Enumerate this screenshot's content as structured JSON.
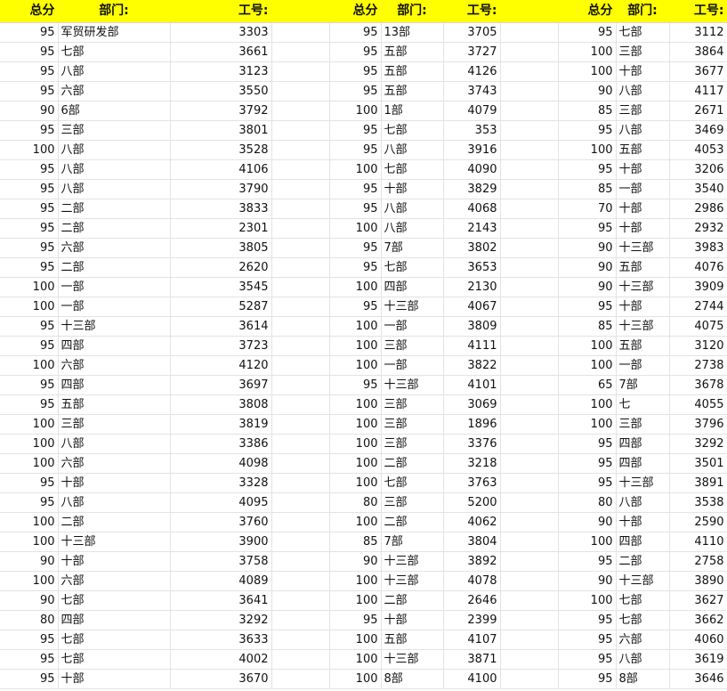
{
  "headers": {
    "score": "总分",
    "dept": "部门:",
    "id": "工号:"
  },
  "groups": [
    {
      "rows": [
        [
          "95",
          "军贸研发部",
          "3303"
        ],
        [
          "95",
          "七部",
          "3661"
        ],
        [
          "95",
          "八部",
          "3123"
        ],
        [
          "95",
          "六部",
          "3550"
        ],
        [
          "90",
          "6部",
          "3792"
        ],
        [
          "95",
          "三部",
          "3801"
        ],
        [
          "100",
          "八部",
          "3528"
        ],
        [
          "95",
          "八部",
          "4106"
        ],
        [
          "95",
          "八部",
          "3790"
        ],
        [
          "95",
          "二部",
          "3833"
        ],
        [
          "95",
          "二部",
          "2301"
        ],
        [
          "95",
          "六部",
          "3805"
        ],
        [
          "95",
          "二部",
          "2620"
        ],
        [
          "100",
          "一部",
          "3545"
        ],
        [
          "100",
          "一部",
          "5287"
        ],
        [
          "95",
          "十三部",
          "3614"
        ],
        [
          "95",
          "四部",
          "3723"
        ],
        [
          "100",
          "六部",
          "4120"
        ],
        [
          "95",
          "四部",
          "3697"
        ],
        [
          "95",
          "五部",
          "3808"
        ],
        [
          "100",
          "三部",
          "3819"
        ],
        [
          "100",
          "八部",
          "3386"
        ],
        [
          "100",
          "六部",
          "4098"
        ],
        [
          "95",
          "十部",
          "3328"
        ],
        [
          "95",
          "八部",
          "4095"
        ],
        [
          "100",
          "二部",
          "3760"
        ],
        [
          "100",
          "十三部",
          "3900"
        ],
        [
          "90",
          "十部",
          "3758"
        ],
        [
          "100",
          "六部",
          "4089"
        ],
        [
          "90",
          "七部",
          "3641"
        ],
        [
          "80",
          "四部",
          "3292"
        ],
        [
          "95",
          "七部",
          "3633"
        ],
        [
          "95",
          "七部",
          "4002"
        ],
        [
          "95",
          "十部",
          "3670"
        ]
      ]
    },
    {
      "rows": [
        [
          "95",
          "13部",
          "3705"
        ],
        [
          "95",
          "五部",
          "3727"
        ],
        [
          "95",
          "五部",
          "4126"
        ],
        [
          "95",
          "五部",
          "3743"
        ],
        [
          "100",
          "1部",
          "4079"
        ],
        [
          "95",
          "七部",
          "353"
        ],
        [
          "95",
          "八部",
          "3916"
        ],
        [
          "100",
          "七部",
          "4090"
        ],
        [
          "95",
          "十部",
          "3829"
        ],
        [
          "95",
          "八部",
          "4068"
        ],
        [
          "100",
          "八部",
          "2143"
        ],
        [
          "95",
          "7部",
          "3802"
        ],
        [
          "95",
          "七部",
          "3653"
        ],
        [
          "100",
          "四部",
          "2130"
        ],
        [
          "95",
          "十三部",
          "4067"
        ],
        [
          "100",
          "一部",
          "3809"
        ],
        [
          "100",
          "三部",
          "4111"
        ],
        [
          "100",
          "一部",
          "3822"
        ],
        [
          "95",
          "十三部",
          "4101"
        ],
        [
          "100",
          "三部",
          "3069"
        ],
        [
          "100",
          "三部",
          "1896"
        ],
        [
          "100",
          "三部",
          "3376"
        ],
        [
          "100",
          "二部",
          "3218"
        ],
        [
          "100",
          "七部",
          "3763"
        ],
        [
          "80",
          "三部",
          "5200"
        ],
        [
          "100",
          "二部",
          "4062"
        ],
        [
          "85",
          "7部",
          "3804"
        ],
        [
          "90",
          "十三部",
          "3892"
        ],
        [
          "100",
          "十三部",
          "4078"
        ],
        [
          "100",
          "二部",
          "2646"
        ],
        [
          "95",
          "十部",
          "2399"
        ],
        [
          "100",
          "五部",
          "4107"
        ],
        [
          "100",
          "十三部",
          "3871"
        ],
        [
          "100",
          "8部",
          "4100"
        ]
      ]
    },
    {
      "rows": [
        [
          "95",
          "七部",
          "3112"
        ],
        [
          "100",
          "三部",
          "3864"
        ],
        [
          "100",
          "十部",
          "3677"
        ],
        [
          "90",
          "八部",
          "4117"
        ],
        [
          "85",
          "三部",
          "2671"
        ],
        [
          "95",
          "八部",
          "3469"
        ],
        [
          "100",
          "五部",
          "4053"
        ],
        [
          "95",
          "十部",
          "3206"
        ],
        [
          "85",
          "一部",
          "3540"
        ],
        [
          "70",
          "十部",
          "2986"
        ],
        [
          "95",
          "十部",
          "2932"
        ],
        [
          "90",
          "十三部",
          "3983"
        ],
        [
          "90",
          "五部",
          "4076"
        ],
        [
          "90",
          "十三部",
          "3909"
        ],
        [
          "95",
          "十部",
          "2744"
        ],
        [
          "85",
          "十三部",
          "4075"
        ],
        [
          "100",
          "五部",
          "3120"
        ],
        [
          "100",
          "一部",
          "2738"
        ],
        [
          "65",
          "7部",
          "3678"
        ],
        [
          "100",
          "七",
          "4055"
        ],
        [
          "100",
          "三部",
          "3796"
        ],
        [
          "95",
          "四部",
          "3292"
        ],
        [
          "95",
          "四部",
          "3501"
        ],
        [
          "95",
          "十三部",
          "3891"
        ],
        [
          "80",
          "八部",
          "3538"
        ],
        [
          "90",
          "十部",
          "2590"
        ],
        [
          "100",
          "四部",
          "4110"
        ],
        [
          "95",
          "二部",
          "2758"
        ],
        [
          "90",
          "十三部",
          "3890"
        ],
        [
          "100",
          "七部",
          "3627"
        ],
        [
          "95",
          "七部",
          "3662"
        ],
        [
          "95",
          "六部",
          "4060"
        ],
        [
          "95",
          "八部",
          "3619"
        ],
        [
          "95",
          "8部",
          "3646"
        ]
      ]
    }
  ]
}
